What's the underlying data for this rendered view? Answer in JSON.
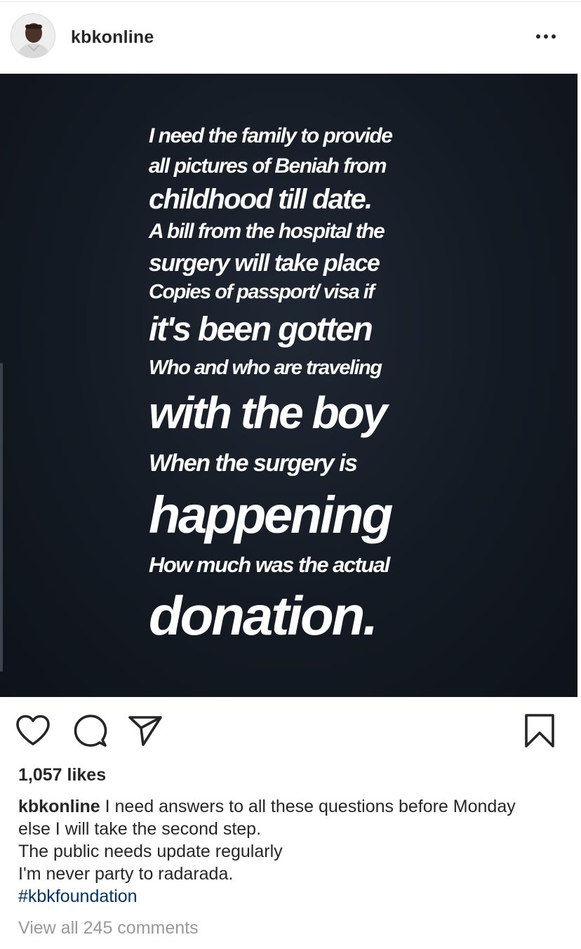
{
  "post": {
    "username": "kbkonline",
    "more_icon": "more-horizontal-icon",
    "image_lines": [
      "I need the family to provide",
      "all pictures of Beniah from",
      "childhood till date.",
      "A bill from the hospital the",
      "surgery will take place",
      "Copies of passport/ visa if",
      "it's been gotten",
      "Who and who are traveling",
      "with the boy",
      "When the surgery is",
      "happening",
      "How much was the actual",
      "donation."
    ],
    "likes": "1,057 likes",
    "caption": {
      "username": "kbkonline",
      "text_line1": "I need answers to all these questions before Monday",
      "text_line2": "else I will take the second step.",
      "text_line3": "The public needs update regularly",
      "text_line4": "I'm never party to radarada.",
      "hashtag": "#kbkfoundation"
    },
    "view_comments": "View all 245 comments"
  },
  "actions": {
    "like_icon": "heart-icon",
    "comment_icon": "comment-icon",
    "share_icon": "paper-plane-icon",
    "save_icon": "bookmark-icon"
  },
  "colors": {
    "text": "#262626",
    "hashtag": "#003569",
    "muted": "#999999",
    "image_bg": "#141a23"
  }
}
